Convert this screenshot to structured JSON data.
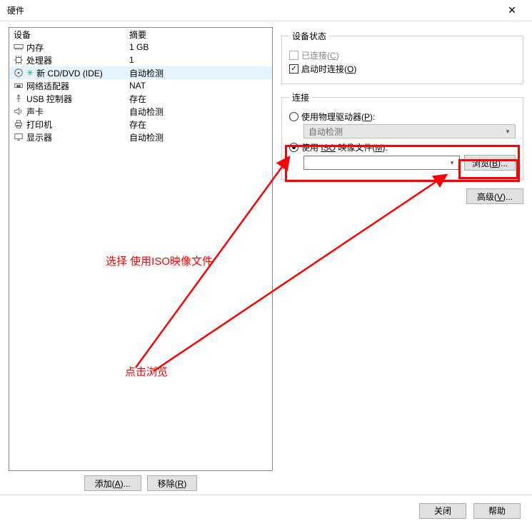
{
  "window": {
    "title": "硬件"
  },
  "devices": {
    "header_device": "设备",
    "header_summary": "摘要",
    "rows": [
      {
        "name": "内存",
        "summary": "1 GB",
        "selected": false,
        "icon": "memory"
      },
      {
        "name": "处理器",
        "summary": "1",
        "selected": false,
        "icon": "cpu"
      },
      {
        "name": "新 CD/DVD (IDE)",
        "summary": "自动检测",
        "selected": true,
        "icon": "disc"
      },
      {
        "name": "网络适配器",
        "summary": "NAT",
        "selected": false,
        "icon": "net"
      },
      {
        "name": "USB 控制器",
        "summary": "存在",
        "selected": false,
        "icon": "usb"
      },
      {
        "name": "声卡",
        "summary": "自动检测",
        "selected": false,
        "icon": "sound"
      },
      {
        "name": "打印机",
        "summary": "存在",
        "selected": false,
        "icon": "printer"
      },
      {
        "name": "显示器",
        "summary": "自动检测",
        "selected": false,
        "icon": "display"
      }
    ]
  },
  "buttons": {
    "add": "添加(",
    "add_u": "A",
    "add_suffix": ")...",
    "remove": "移除(",
    "remove_u": "R",
    "remove_suffix": ")"
  },
  "status": {
    "legend": "设备状态",
    "connected": "已连接(",
    "connected_u": "C",
    "connected_suffix": ")",
    "connect_on": "启动时连接(",
    "connect_on_u": "O",
    "connect_on_suffix": ")"
  },
  "connection": {
    "legend": "连接",
    "use_physical": "使用物理驱动器(",
    "use_physical_u": "P",
    "use_physical_suffix": "):",
    "auto_detect": "自动检测",
    "use_iso_pre": "使用 ",
    "use_iso_mid": "ISO",
    "use_iso_post": " 映像文件(",
    "use_iso_u": "M",
    "use_iso_suffix": "):",
    "iso_value": "",
    "browse": "浏览(",
    "browse_u": "B",
    "browse_suffix": ")..."
  },
  "advanced": {
    "label": "高级(",
    "u": "V",
    "suffix": ")..."
  },
  "footer": {
    "close": "关闭",
    "help": "帮助"
  },
  "annotations": {
    "a1": "选择 使用ISO映像文件",
    "a2": "点击浏览"
  },
  "watermark": ""
}
